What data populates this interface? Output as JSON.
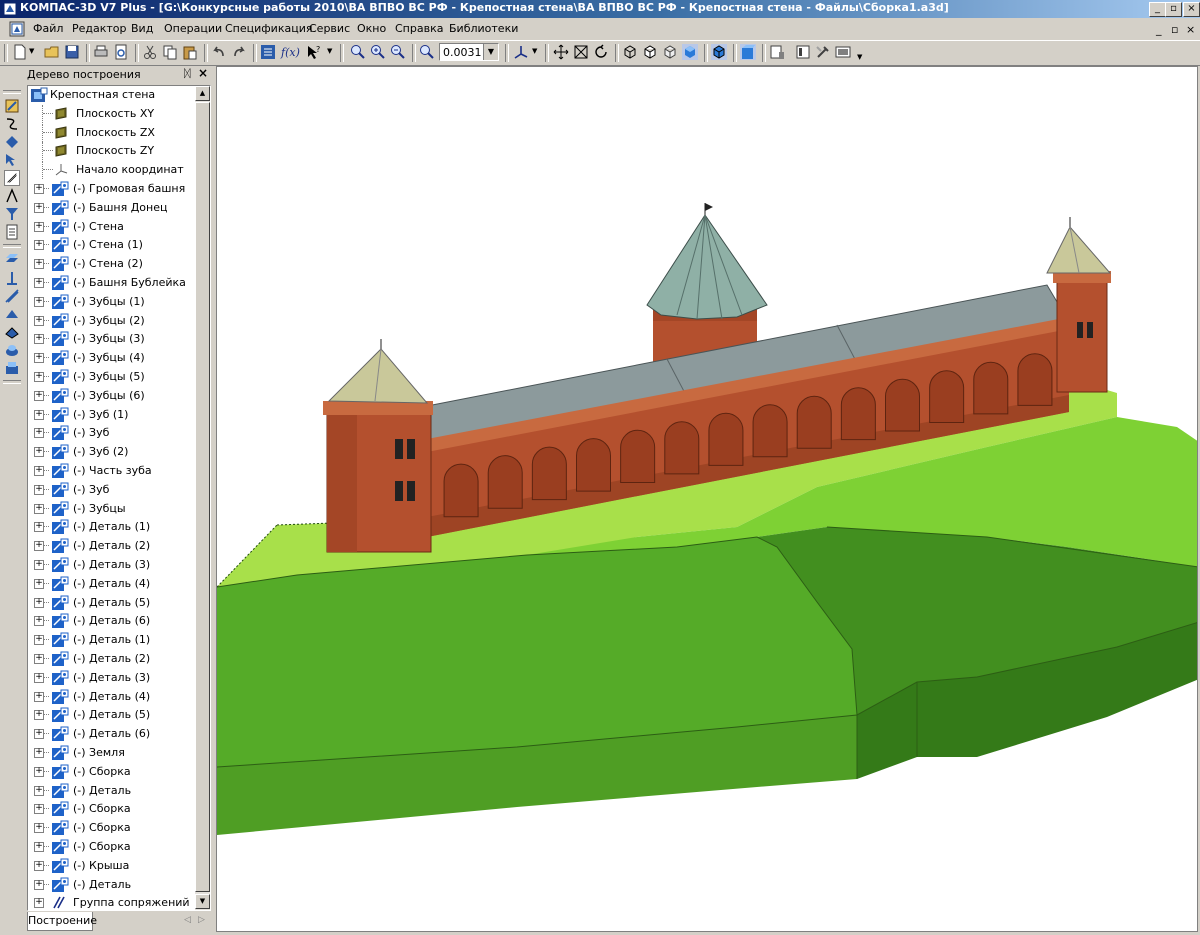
{
  "window": {
    "title": "КОМПАС-3D V7 Plus - [G:\\Конкурсные работы 2010\\ВА ВПВО ВС РФ - Крепостная стена\\ВА ВПВО ВС РФ - Крепостная стена - Файлы\\Сборка1.a3d]",
    "min_glyph": "_",
    "max_glyph": "▫",
    "close_glyph": "×",
    "mdi_min": "_",
    "mdi_restore": "▫",
    "mdi_close": "×"
  },
  "menu": [
    {
      "name": "menu-file",
      "label": "Файл"
    },
    {
      "name": "menu-editor",
      "label": "Редактор"
    },
    {
      "name": "menu-view",
      "label": "Вид"
    },
    {
      "name": "menu-operations",
      "label": "Операции"
    },
    {
      "name": "menu-specification",
      "label": "Спецификация"
    },
    {
      "name": "menu-service",
      "label": "Сервис"
    },
    {
      "name": "menu-window",
      "label": "Окно"
    },
    {
      "name": "menu-help",
      "label": "Справка"
    },
    {
      "name": "menu-libraries",
      "label": "Библиотеки"
    }
  ],
  "toolbar": {
    "zoom_value": "0.0031",
    "dropdown_glyph": "▼",
    "icons": [
      "new-document-icon",
      "open-folder-icon",
      "save-icon",
      "print-icon",
      "print-preview-icon",
      "cut-icon",
      "copy-icon",
      "paste-icon",
      "undo-icon",
      "redo-icon",
      "variables-icon",
      "function-icon",
      "help-cursor-icon",
      "zoom-window-icon",
      "zoom-in-icon",
      "zoom-out-icon",
      "zoom-scale-icon",
      "orientation-icon",
      "pan-icon",
      "zoom-fit-icon",
      "rotate-icon",
      "wireframe-icon",
      "hidden-lines-icon",
      "hidden-lines-thin-icon",
      "shaded-icon",
      "shaded-edges-icon",
      "perspective-icon",
      "properties-icon",
      "tools-icon",
      "display-icon"
    ]
  },
  "tree": {
    "header": "Дерево построения",
    "pin_glyph": "ᛞ",
    "close_glyph": "×",
    "root": "Крепостная стена",
    "system_items": [
      {
        "label": "Плоскость XY",
        "icon": "plane-icon"
      },
      {
        "label": "Плоскость ZX",
        "icon": "plane-icon"
      },
      {
        "label": "Плоскость ZY",
        "icon": "plane-icon"
      },
      {
        "label": "Начало координат",
        "icon": "origin-icon"
      }
    ],
    "components": [
      "(-) Громовая башня",
      "(-) Башня Донец",
      "(-) Стена",
      "(-) Стена (1)",
      "(-) Стена (2)",
      "(-) Башня Бублейка",
      "(-) Зубцы (1)",
      "(-) Зубцы (2)",
      "(-) Зубцы (3)",
      "(-) Зубцы (4)",
      "(-) Зубцы (5)",
      "(-) Зубцы (6)",
      "(-) Зуб (1)",
      "(-) Зуб",
      "(-) Зуб (2)",
      "(-) Часть зуба",
      "(-) Зуб",
      "(-) Зубцы",
      "(-) Деталь (1)",
      "(-) Деталь (2)",
      "(-) Деталь (3)",
      "(-) Деталь (4)",
      "(-) Деталь (5)",
      "(-) Деталь (6)",
      "(-) Деталь (1)",
      "(-) Деталь (2)",
      "(-) Деталь (3)",
      "(-) Деталь (4)",
      "(-) Деталь (5)",
      "(-) Деталь (6)",
      "(-) Земля",
      "(-) Сборка",
      "(-) Деталь",
      "(-) Сборка",
      "(-) Сборка",
      "(-) Сборка",
      "(-) Крыша",
      "(-) Деталь"
    ],
    "mates": "Группа сопряжений",
    "expand_glyph": "+",
    "tab": "Построение",
    "tab_prev": "◁",
    "tab_next": "▷",
    "scroll_up": "▲",
    "scroll_down": "▼"
  },
  "viewport": {
    "colors": {
      "grass_light": "#a8e04a",
      "grass_mid": "#6cc22a",
      "slope_front": "#52a826",
      "slope_side": "#3e8c1e",
      "base_front": "#4f9e24",
      "base_side": "#347a18",
      "brick": "#b4502e",
      "brick_dark": "#8e3a1f",
      "roof_wall": "#8c9a9c",
      "roof_tower": "#c9c89a",
      "roof_center": "#8fb0a6"
    }
  }
}
